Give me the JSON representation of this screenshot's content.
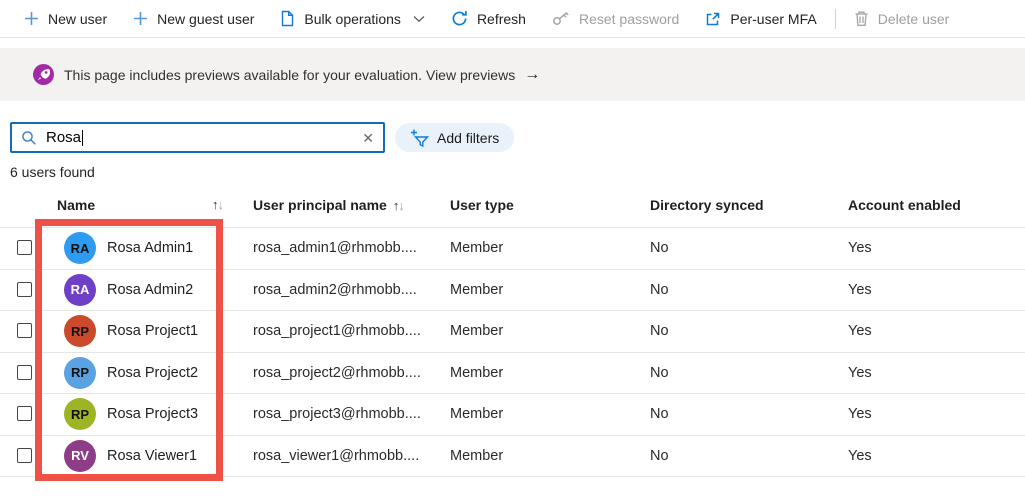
{
  "toolbar": {
    "new_user": "New user",
    "new_guest_user": "New guest user",
    "bulk_operations": "Bulk operations",
    "refresh": "Refresh",
    "reset_password": "Reset password",
    "per_user_mfa": "Per-user MFA",
    "delete_user": "Delete user"
  },
  "banner": {
    "message": "This page includes previews available for your evaluation.",
    "link_label": "View previews",
    "arrow": "→"
  },
  "search": {
    "value": "Rosa",
    "clear_icon": "✕"
  },
  "add_filters_label": "Add filters",
  "results_count": "6 users found",
  "table": {
    "headers": {
      "name": "Name",
      "upn": "User principal name",
      "user_type": "User type",
      "directory_synced": "Directory synced",
      "account_enabled": "Account enabled",
      "sort_up": "↑",
      "sort_down": "↓"
    },
    "rows": [
      {
        "initials": "RA",
        "name": "Rosa Admin1",
        "upn": "rosa_admin1@rhmobb....",
        "user_type": "Member",
        "directory_synced": "No",
        "account_enabled": "Yes",
        "avatar_style": "background:#2e9af0;color:#121212"
      },
      {
        "initials": "RA",
        "name": "Rosa Admin2",
        "upn": "rosa_admin2@rhmobb....",
        "user_type": "Member",
        "directory_synced": "No",
        "account_enabled": "Yes",
        "avatar_style": "background:#6f40c7;color:#ffffff"
      },
      {
        "initials": "RP",
        "name": "Rosa Project1",
        "upn": "rosa_project1@rhmobb....",
        "user_type": "Member",
        "directory_synced": "No",
        "account_enabled": "Yes",
        "avatar_style": "background:#cb4a2b;color:#121212"
      },
      {
        "initials": "RP",
        "name": "Rosa Project2",
        "upn": "rosa_project2@rhmobb....",
        "user_type": "Member",
        "directory_synced": "No",
        "account_enabled": "Yes",
        "avatar_style": "background:#5ba2e2;color:#121212"
      },
      {
        "initials": "RP",
        "name": "Rosa Project3",
        "upn": "rosa_project3@rhmobb....",
        "user_type": "Member",
        "directory_synced": "No",
        "account_enabled": "Yes",
        "avatar_style": "background:#9db424;color:#121212"
      },
      {
        "initials": "RV",
        "name": "Rosa Viewer1",
        "upn": "rosa_viewer1@rhmobb....",
        "user_type": "Member",
        "directory_synced": "No",
        "account_enabled": "Yes",
        "avatar_style": "background:#8c3d86;color:#ffffff"
      }
    ]
  },
  "annotation_color": "#ee5145"
}
